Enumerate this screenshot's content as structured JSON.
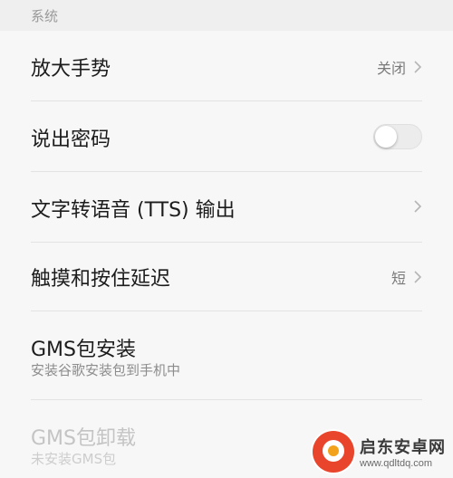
{
  "section": {
    "label": "系统"
  },
  "items": [
    {
      "title": "放大手势",
      "value": "关闭"
    },
    {
      "title": "说出密码"
    },
    {
      "title": "文字转语音 (TTS) 输出"
    },
    {
      "title": "触摸和按住延迟",
      "value": "短"
    },
    {
      "title": "GMS包安装",
      "subtitle": "安装谷歌安装包到手机中"
    },
    {
      "title": "GMS包卸载",
      "subtitle": "未安装GMS包"
    }
  ],
  "watermark": {
    "name": "启东安卓网",
    "url": "www.qdltdq.com"
  },
  "colors": {
    "background": "#f7f7f7",
    "header_bg": "#efefef",
    "brand_red": "#e8452c"
  }
}
